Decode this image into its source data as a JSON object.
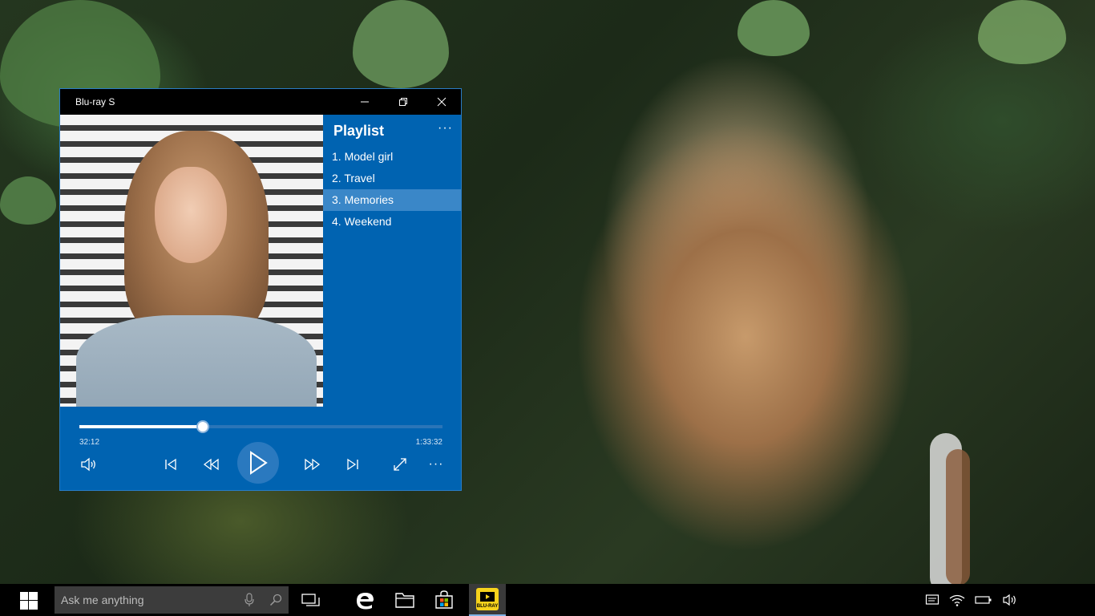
{
  "window": {
    "title": "Blu-ray S",
    "minimize_icon": "minimize-icon",
    "maximize_icon": "restore-icon",
    "close_icon": "close-icon"
  },
  "playlist": {
    "heading": "Playlist",
    "more_label": "···",
    "items": [
      {
        "label": "1. Model girl",
        "active": false
      },
      {
        "label": "2. Travel",
        "active": false
      },
      {
        "label": "3. Memories",
        "active": true
      },
      {
        "label": "4. Weekend",
        "active": false
      }
    ]
  },
  "player": {
    "current_time": "32:12",
    "total_time": "1:33:32",
    "progress": 0.34,
    "more_label": "···"
  },
  "taskbar": {
    "search_placeholder": "Ask me anything",
    "app_label": "BLU-RAY"
  },
  "colors": {
    "accent": "#0063b1",
    "playlist_active": "#3a87c8",
    "app_icon": "#f6d21c"
  }
}
